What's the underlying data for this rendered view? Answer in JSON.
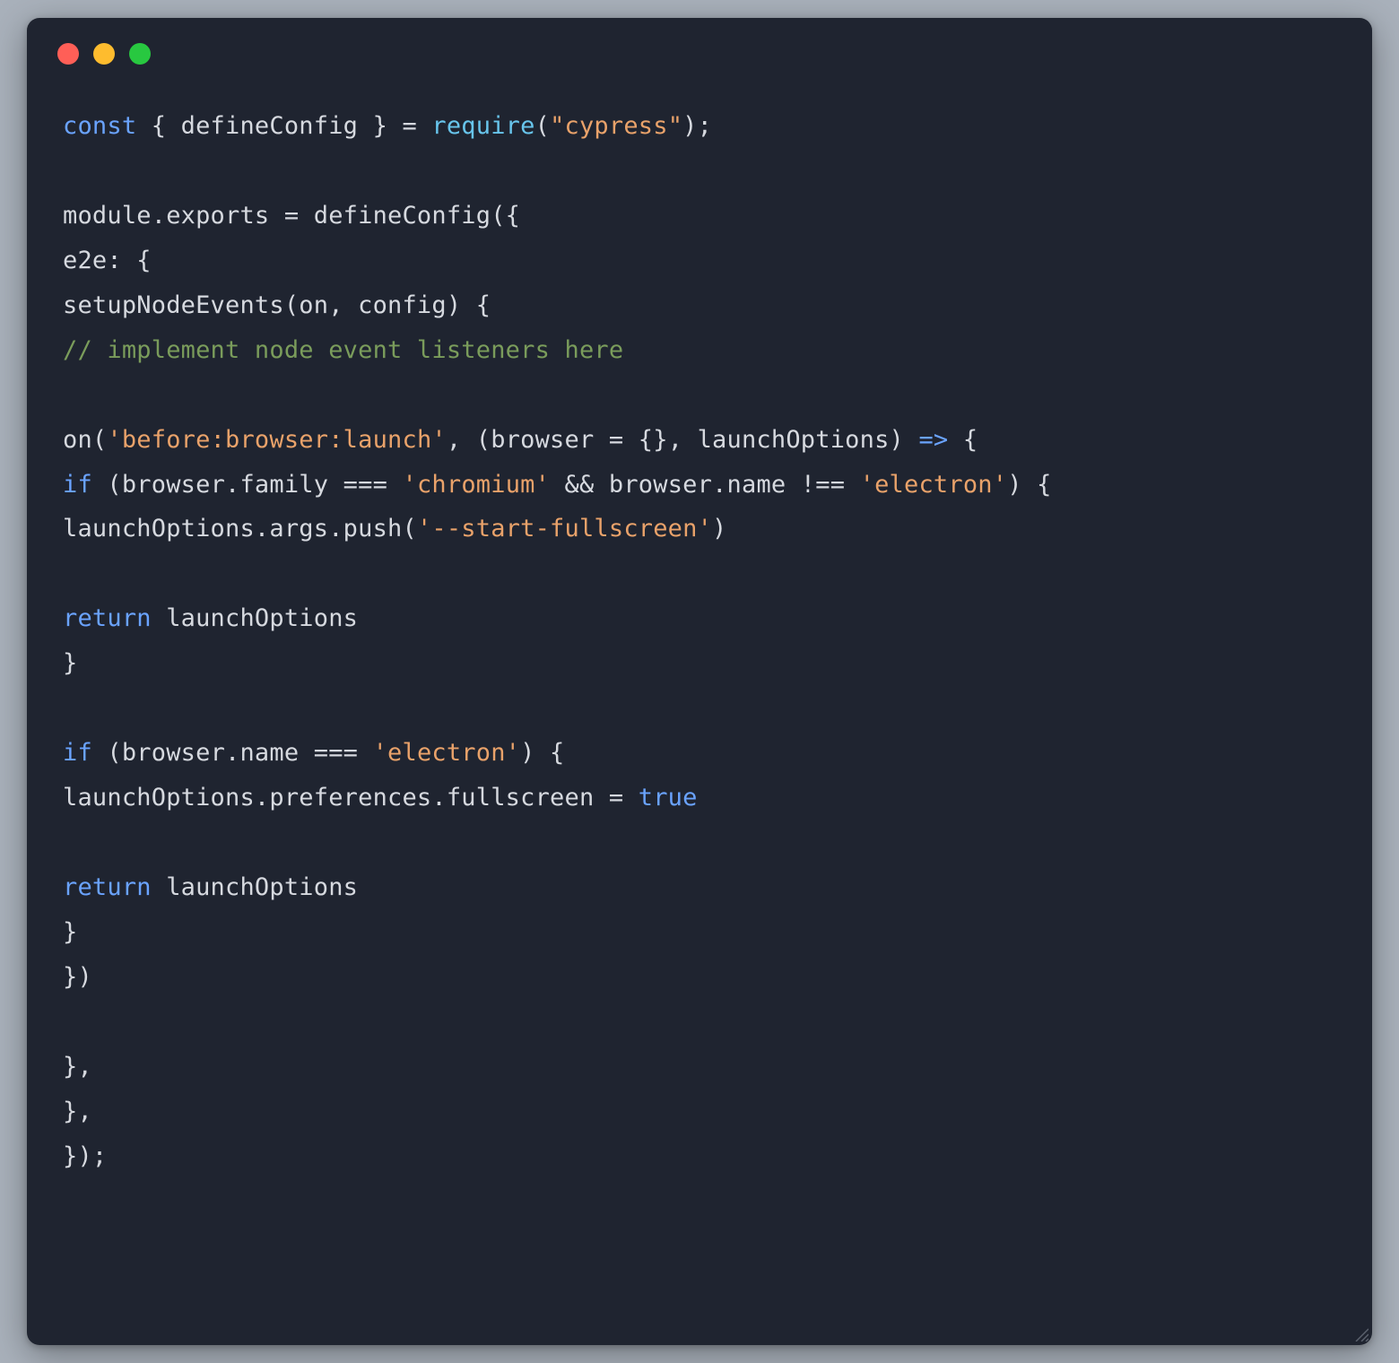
{
  "colors": {
    "bg": "#1f2430",
    "page": "#a9b1bb",
    "text": "#d6d9df",
    "keyword": "#6aa3ff",
    "func": "#68c5ec",
    "string": "#e9a26a",
    "comment": "#7a9c5b",
    "dot_red": "#ff5f57",
    "dot_yellow": "#febc2e",
    "dot_green": "#28c840"
  },
  "code": {
    "l1": {
      "kw_const": "const",
      "destruct": " { defineConfig } = ",
      "fn_require": "require",
      "paren_open": "(",
      "str_cypress": "\"cypress\"",
      "paren_close_semi": ");"
    },
    "l2": "",
    "l3": "module.exports = defineConfig({",
    "l4": "e2e: {",
    "l5": "setupNodeEvents(on, config) {",
    "l6_comment": "// implement node event listeners here",
    "l7": "",
    "l8": {
      "pre": "on(",
      "str_event": "'before:browser:launch'",
      "mid": ", (browser = {}, launchOptions) ",
      "arrow": "=>",
      "post": " {"
    },
    "l9": {
      "kw_if": "if",
      "pre": " (browser.family === ",
      "str_chromium": "'chromium'",
      "mid": " && browser.name !== ",
      "str_electron": "'electron'",
      "post": ") {"
    },
    "l10": {
      "pre": "launchOptions.args.push(",
      "str_flag": "'--start-fullscreen'",
      "post": ")"
    },
    "l11": "",
    "l12": {
      "kw_return": "return",
      "rest": " launchOptions"
    },
    "l13": "}",
    "l14": "",
    "l15": {
      "kw_if": "if",
      "pre": " (browser.name === ",
      "str_electron": "'electron'",
      "post": ") {"
    },
    "l16": {
      "pre": "launchOptions.preferences.fullscreen = ",
      "kw_true": "true"
    },
    "l17": "",
    "l18": {
      "kw_return": "return",
      "rest": " launchOptions"
    },
    "l19": "}",
    "l20": "})",
    "l21": "",
    "l22": "},",
    "l23": "},",
    "l24": "});"
  }
}
